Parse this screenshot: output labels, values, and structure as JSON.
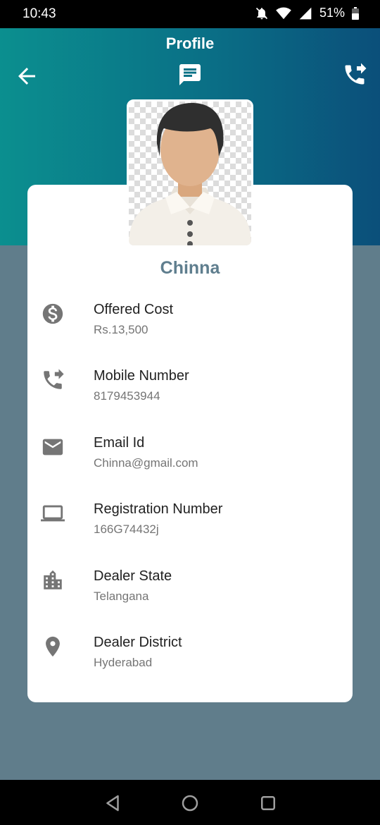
{
  "status_bar": {
    "time": "10:43",
    "battery": "51%"
  },
  "header": {
    "title": "Profile"
  },
  "profile": {
    "name": "Chinna"
  },
  "details": [
    {
      "label": "Offered Cost",
      "value": "Rs.13,500",
      "icon": "dollar-circle-icon"
    },
    {
      "label": "Mobile Number",
      "value": "8179453944",
      "icon": "phone-forward-icon"
    },
    {
      "label": "Email Id",
      "value": "Chinna@gmail.com",
      "icon": "mail-icon"
    },
    {
      "label": "Registration Number",
      "value": "166G74432j",
      "icon": "laptop-icon"
    },
    {
      "label": "Dealer State",
      "value": "Telangana",
      "icon": "building-icon"
    },
    {
      "label": "Dealer District",
      "value": "Hyderabad",
      "icon": "location-pin-icon"
    }
  ],
  "colors": {
    "header_start": "#0b8f8f",
    "header_end": "#0b4f7a",
    "background": "#607d8b",
    "name": "#5f7e8e",
    "icon": "#757575"
  }
}
